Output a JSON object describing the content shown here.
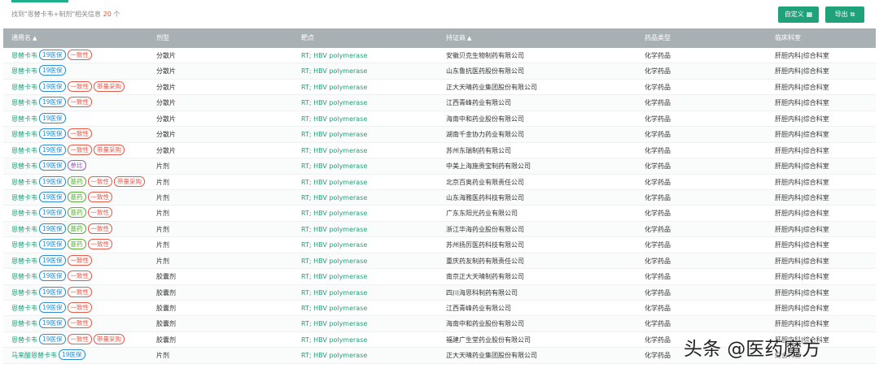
{
  "toolbar": {
    "result_prefix": "找到\"恩替卡韦+制剂\"相关信息",
    "result_count": "20",
    "result_suffix": "个",
    "custom_label": "自定义",
    "export_label": "导出",
    "custom_icon": "grid-icon",
    "export_icon": "external-link-icon"
  },
  "columns": [
    {
      "label": "通用名",
      "sortable": true
    },
    {
      "label": "剂型",
      "sortable": false
    },
    {
      "label": "靶点",
      "sortable": false
    },
    {
      "label": "持证商",
      "sortable": true
    },
    {
      "label": "药品类型",
      "sortable": false
    },
    {
      "label": "临床科室",
      "sortable": false
    }
  ],
  "tag_labels": {
    "ins": "19医保",
    "con": "一致性",
    "vol": "带量采购",
    "ess": "基药",
    "ref": "参比"
  },
  "rows": [
    {
      "name": "恩替卡韦",
      "tags": [
        "ins",
        "con"
      ],
      "form": "分散片",
      "target": "RT; HBV polymerase",
      "holder": "安徽贝克生物制药有限公司",
      "type": "化学药品",
      "dept": "肝胆内科|综合科室"
    },
    {
      "name": "恩替卡韦",
      "tags": [
        "ins"
      ],
      "form": "分散片",
      "target": "RT; HBV polymerase",
      "holder": "山东鲁抗医药股份有限公司",
      "type": "化学药品",
      "dept": "肝胆内科|综合科室"
    },
    {
      "name": "恩替卡韦",
      "tags": [
        "ins",
        "con",
        "vol"
      ],
      "form": "分散片",
      "target": "RT; HBV polymerase",
      "holder": "正大天晴药业集团股份有限公司",
      "type": "化学药品",
      "dept": "肝胆内科|综合科室"
    },
    {
      "name": "恩替卡韦",
      "tags": [
        "ins",
        "con"
      ],
      "form": "分散片",
      "target": "RT; HBV polymerase",
      "holder": "江西青峰药业有限公司",
      "type": "化学药品",
      "dept": "肝胆内科|综合科室"
    },
    {
      "name": "恩替卡韦",
      "tags": [
        "ins"
      ],
      "form": "分散片",
      "target": "RT; HBV polymerase",
      "holder": "海南中和药业股份有限公司",
      "type": "化学药品",
      "dept": "肝胆内科|综合科室"
    },
    {
      "name": "恩替卡韦",
      "tags": [
        "ins",
        "con"
      ],
      "form": "分散片",
      "target": "RT; HBV polymerase",
      "holder": "湖南千金协力药业有限公司",
      "type": "化学药品",
      "dept": "肝胆内科|综合科室"
    },
    {
      "name": "恩替卡韦",
      "tags": [
        "ins",
        "con",
        "vol"
      ],
      "form": "分散片",
      "target": "RT; HBV polymerase",
      "holder": "苏州东瑞制药有限公司",
      "type": "化学药品",
      "dept": "肝胆内科|综合科室"
    },
    {
      "name": "恩替卡韦",
      "tags": [
        "ins",
        "ref"
      ],
      "form": "片剂",
      "target": "RT; HBV polymerase",
      "holder": "中美上海施贵宝制药有限公司",
      "type": "化学药品",
      "dept": "肝胆内科|综合科室"
    },
    {
      "name": "恩替卡韦",
      "tags": [
        "ins",
        "ess",
        "con",
        "vol"
      ],
      "form": "片剂",
      "target": "RT; HBV polymerase",
      "holder": "北京百奥药业有限责任公司",
      "type": "化学药品",
      "dept": "肝胆内科|综合科室"
    },
    {
      "name": "恩替卡韦",
      "tags": [
        "ins",
        "ess",
        "con"
      ],
      "form": "片剂",
      "target": "RT; HBV polymerase",
      "holder": "山东海雅医药科技有限公司",
      "type": "化学药品",
      "dept": "肝胆内科|综合科室"
    },
    {
      "name": "恩替卡韦",
      "tags": [
        "ins",
        "ess",
        "con"
      ],
      "form": "片剂",
      "target": "RT; HBV polymerase",
      "holder": "广东东阳光药业有限公司",
      "type": "化学药品",
      "dept": "肝胆内科|综合科室"
    },
    {
      "name": "恩替卡韦",
      "tags": [
        "ins",
        "ess",
        "con"
      ],
      "form": "片剂",
      "target": "RT; HBV polymerase",
      "holder": "浙江华海药业股份有限公司",
      "type": "化学药品",
      "dept": "肝胆内科|综合科室"
    },
    {
      "name": "恩替卡韦",
      "tags": [
        "ins",
        "ess",
        "con"
      ],
      "form": "片剂",
      "target": "RT; HBV polymerase",
      "holder": "苏州扬厉医药科技有限公司",
      "type": "化学药品",
      "dept": "肝胆内科|综合科室"
    },
    {
      "name": "恩替卡韦",
      "tags": [
        "ins",
        "con"
      ],
      "form": "片剂",
      "target": "RT; HBV polymerase",
      "holder": "重庆药友制药有限责任公司",
      "type": "化学药品",
      "dept": "肝胆内科|综合科室"
    },
    {
      "name": "恩替卡韦",
      "tags": [
        "ins",
        "con"
      ],
      "form": "胶囊剂",
      "target": "RT; HBV polymerase",
      "holder": "南京正大天晴制药有限公司",
      "type": "化学药品",
      "dept": "肝胆内科|综合科室"
    },
    {
      "name": "恩替卡韦",
      "tags": [
        "ins",
        "con"
      ],
      "form": "胶囊剂",
      "target": "RT; HBV polymerase",
      "holder": "四川海思科制药有限公司",
      "type": "化学药品",
      "dept": "肝胆内科|综合科室"
    },
    {
      "name": "恩替卡韦",
      "tags": [
        "ins",
        "con"
      ],
      "form": "胶囊剂",
      "target": "RT; HBV polymerase",
      "holder": "江西青峰药业有限公司",
      "type": "化学药品",
      "dept": "肝胆内科|综合科室"
    },
    {
      "name": "恩替卡韦",
      "tags": [
        "ins",
        "con"
      ],
      "form": "胶囊剂",
      "target": "RT; HBV polymerase",
      "holder": "海南中和药业股份有限公司",
      "type": "化学药品",
      "dept": "肝胆内科|综合科室"
    },
    {
      "name": "恩替卡韦",
      "tags": [
        "ins",
        "con",
        "vol"
      ],
      "form": "胶囊剂",
      "target": "RT; HBV polymerase",
      "holder": "福建广生堂药业股份有限公司",
      "type": "化学药品",
      "dept": "肝胆内科|综合科室"
    },
    {
      "name": "马来酸恩替卡韦",
      "tags": [
        "ins"
      ],
      "form": "片剂",
      "target": "RT; HBV polymerase",
      "holder": "正大天晴药业集团股份有限公司",
      "type": "化学药品",
      "dept": "综合科室"
    }
  ],
  "watermark": "头条 @医药魔方"
}
